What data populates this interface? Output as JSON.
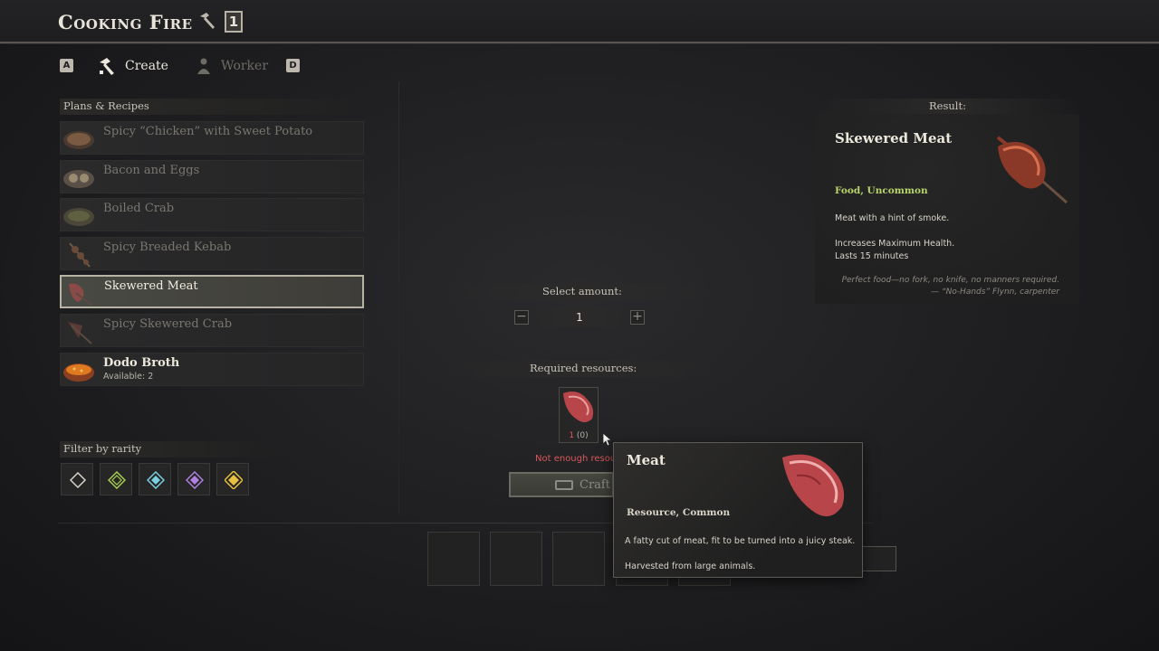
{
  "header": {
    "title": "Cooking Fire",
    "level_badge": "1"
  },
  "tabs": {
    "left_key": "A",
    "right_key": "D",
    "create_label": "Create",
    "worker_label": "Worker"
  },
  "recipes": {
    "section_label": "Plans & Recipes",
    "items": [
      {
        "name": "Spicy “Chicken” with Sweet Potato",
        "state": "unavailable"
      },
      {
        "name": "Bacon and Eggs",
        "state": "unavailable"
      },
      {
        "name": "Boiled Crab",
        "state": "unavailable"
      },
      {
        "name": "Spicy Breaded Kebab",
        "state": "unavailable"
      },
      {
        "name": "Skewered Meat",
        "state": "selected"
      },
      {
        "name": "Spicy Skewered Crab",
        "state": "unavailable"
      },
      {
        "name": "Dodo Broth",
        "state": "available",
        "sub": "Available: 2"
      }
    ]
  },
  "filter": {
    "label": "Filter by rarity",
    "rarities": [
      {
        "name": "common",
        "color": "#d8d4c8"
      },
      {
        "name": "uncommon",
        "color": "#a8d050"
      },
      {
        "name": "rare",
        "color": "#7ad0e0"
      },
      {
        "name": "epic",
        "color": "#b080e0"
      },
      {
        "name": "legendary",
        "color": "#e8c040"
      }
    ]
  },
  "crafting": {
    "amount_label": "Select amount:",
    "amount_value": "1",
    "minus": "−",
    "plus": "+",
    "resources_label": "Required resources:",
    "resource_count_red": "1",
    "resource_count_have": " (0)",
    "warning": "Not enough resources",
    "craft_label": "Craft"
  },
  "result": {
    "label": "Result:",
    "title": "Skewered Meat",
    "category": "Food, Uncommon",
    "desc1": "Meat with a hint of smoke.",
    "desc2": "Increases Maximum Health.",
    "desc3": "Lasts 15 minutes",
    "quote1": "Perfect food—no fork, no knife, no manners required.",
    "quote2": "— “No-Hands” Flynn, carpenter"
  },
  "tooltip": {
    "title": "Meat",
    "category": "Resource, Common",
    "desc1": "A fatty cut of meat, fit to be turned into a juicy steak.",
    "desc2": "Harvested from large animals."
  },
  "colors": {
    "accent_green": "#b8d66a",
    "warning_red": "#d85858",
    "meat": "#b8454a"
  }
}
